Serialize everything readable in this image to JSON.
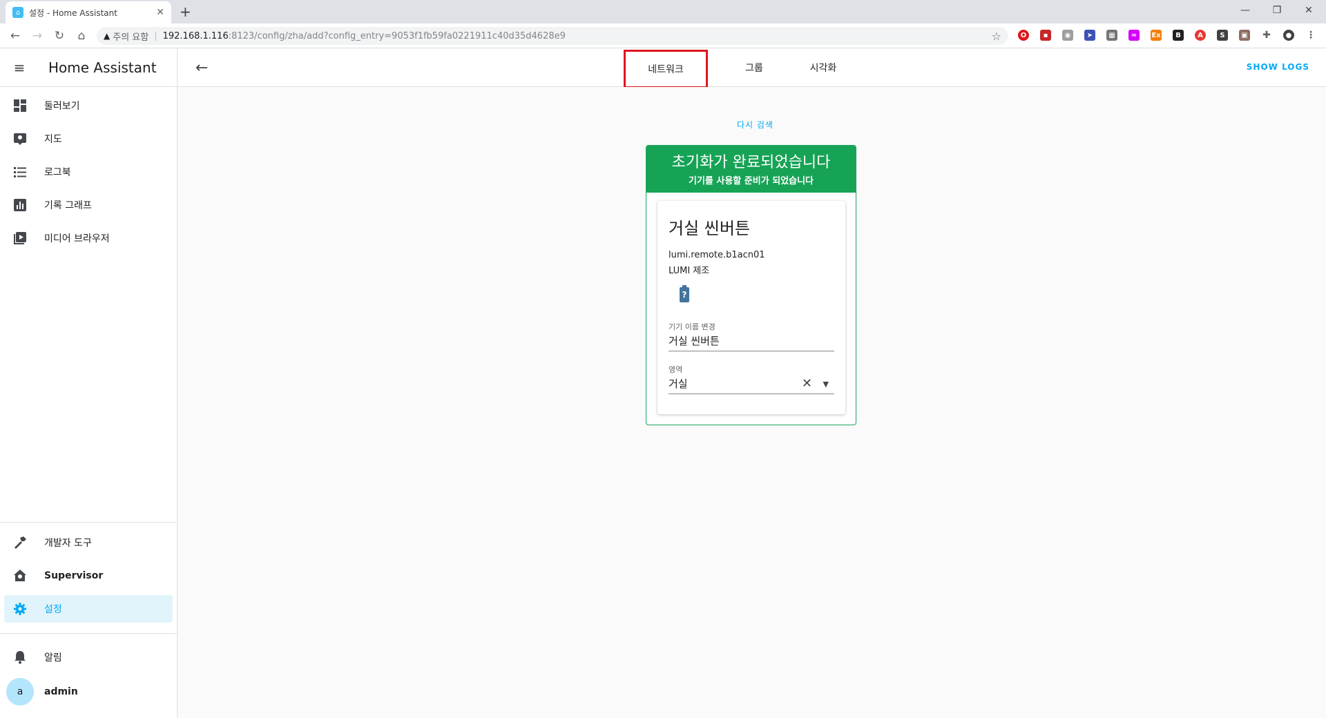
{
  "browser": {
    "tab_title": "설정 - Home Assistant",
    "tab_close": "✕",
    "new_tab": "+",
    "security_label": "주의 요함",
    "url_host": "192.168.1.116",
    "url_path": ":8123/config/zha/add?config_entry=9053f1fb59fa0221911c40d35d4628e9"
  },
  "sidebar": {
    "title": "Home Assistant",
    "items": [
      {
        "label": "둘러보기",
        "icon": "dashboard-icon"
      },
      {
        "label": "지도",
        "icon": "map-icon"
      },
      {
        "label": "로그북",
        "icon": "logbook-icon"
      },
      {
        "label": "기록 그래프",
        "icon": "history-icon"
      },
      {
        "label": "미디어 브라우저",
        "icon": "media-icon"
      }
    ],
    "bottom_items": [
      {
        "label": "개발자 도구",
        "icon": "hammer-icon"
      },
      {
        "label": "Supervisor",
        "icon": "supervisor-icon"
      },
      {
        "label": "설정",
        "icon": "cog-icon"
      }
    ],
    "notifications": "알림",
    "user": {
      "avatar": "a",
      "name": "admin"
    }
  },
  "topbar": {
    "tabs": [
      "네트워크",
      "그룹",
      "시각화"
    ],
    "show_logs": "SHOW LOGS"
  },
  "main": {
    "research": "다시 검색",
    "card": {
      "title": "초기화가 완료되었습니다",
      "subtitle": "기기를 사용할 준비가 되었습니다",
      "device_name": "거실 씬버튼",
      "model": "lumi.remote.b1acn01",
      "manufacturer": "LUMI 제조",
      "battery_glyph": "?",
      "rename_label": "기기 이름 변경",
      "rename_value": "거실 씬버튼",
      "area_label": "영역",
      "area_value": "거실"
    }
  },
  "colors": {
    "accent": "#03a9f4",
    "success": "#17a356",
    "highlight_box": "#e0141c"
  }
}
